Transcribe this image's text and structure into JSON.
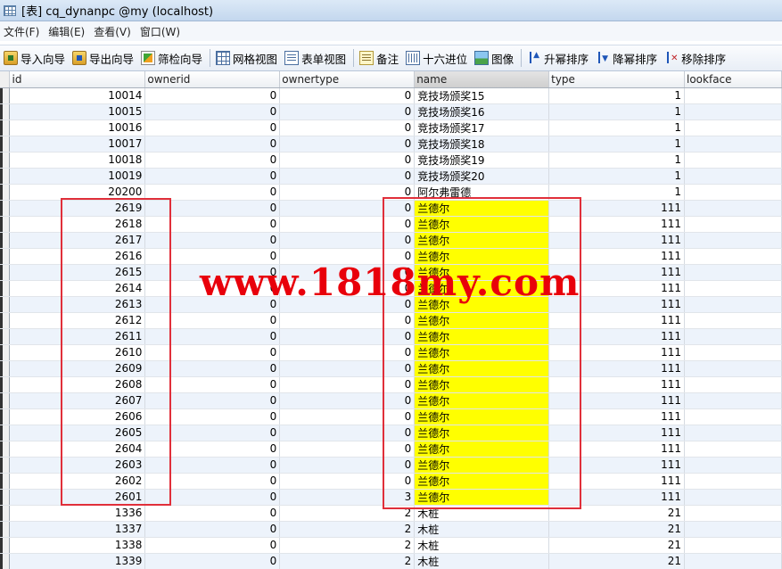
{
  "window": {
    "title": "[表] cq_dynanpc @my (localhost)"
  },
  "menu": [
    "文件(F)",
    "编辑(E)",
    "查看(V)",
    "窗口(W)"
  ],
  "toolbar": {
    "import": "导入向导",
    "export": "导出向导",
    "filter": "筛检向导",
    "grid_view": "网格视图",
    "form_view": "表单视图",
    "memo": "备注",
    "hex": "十六进位",
    "image": "图像",
    "sort_asc": "升幂排序",
    "sort_desc": "降幂排序",
    "remove_sort": "移除排序"
  },
  "columns": [
    "id",
    "ownerid",
    "ownertype",
    "name",
    "type",
    "lookface"
  ],
  "rows": [
    [
      "10014",
      "0",
      "0",
      "竞技场颁奖15",
      "1",
      ""
    ],
    [
      "10015",
      "0",
      "0",
      "竞技场颁奖16",
      "1",
      ""
    ],
    [
      "10016",
      "0",
      "0",
      "竞技场颁奖17",
      "1",
      ""
    ],
    [
      "10017",
      "0",
      "0",
      "竞技场颁奖18",
      "1",
      ""
    ],
    [
      "10018",
      "0",
      "0",
      "竞技场颁奖19",
      "1",
      ""
    ],
    [
      "10019",
      "0",
      "0",
      "竞技场颁奖20",
      "1",
      ""
    ],
    [
      "20200",
      "0",
      "0",
      "阿尔弗雷德",
      "1",
      ""
    ],
    [
      "2619",
      "0",
      "0",
      "兰德尔",
      "111",
      ""
    ],
    [
      "2618",
      "0",
      "0",
      "兰德尔",
      "111",
      ""
    ],
    [
      "2617",
      "0",
      "0",
      "兰德尔",
      "111",
      ""
    ],
    [
      "2616",
      "0",
      "0",
      "兰德尔",
      "111",
      ""
    ],
    [
      "2615",
      "0",
      "0",
      "兰德尔",
      "111",
      ""
    ],
    [
      "2614",
      "0",
      "0",
      "兰德尔",
      "111",
      ""
    ],
    [
      "2613",
      "0",
      "0",
      "兰德尔",
      "111",
      ""
    ],
    [
      "2612",
      "0",
      "0",
      "兰德尔",
      "111",
      ""
    ],
    [
      "2611",
      "0",
      "0",
      "兰德尔",
      "111",
      ""
    ],
    [
      "2610",
      "0",
      "0",
      "兰德尔",
      "111",
      ""
    ],
    [
      "2609",
      "0",
      "0",
      "兰德尔",
      "111",
      ""
    ],
    [
      "2608",
      "0",
      "0",
      "兰德尔",
      "111",
      ""
    ],
    [
      "2607",
      "0",
      "0",
      "兰德尔",
      "111",
      ""
    ],
    [
      "2606",
      "0",
      "0",
      "兰德尔",
      "111",
      ""
    ],
    [
      "2605",
      "0",
      "0",
      "兰德尔",
      "111",
      ""
    ],
    [
      "2604",
      "0",
      "0",
      "兰德尔",
      "111",
      ""
    ],
    [
      "2603",
      "0",
      "0",
      "兰德尔",
      "111",
      ""
    ],
    [
      "2602",
      "0",
      "0",
      "兰德尔",
      "111",
      ""
    ],
    [
      "2601",
      "0",
      "3",
      "兰德尔",
      "111",
      ""
    ],
    [
      "1336",
      "0",
      "2",
      "木桩",
      "21",
      ""
    ],
    [
      "1337",
      "0",
      "2",
      "木桩",
      "21",
      ""
    ],
    [
      "1338",
      "0",
      "2",
      "木桩",
      "21",
      ""
    ],
    [
      "1339",
      "0",
      "2",
      "木桩",
      "21",
      ""
    ]
  ],
  "highlight": {
    "name_color": "#ffff00",
    "box_color": "#e02f3a",
    "first_row": 7,
    "last_row": 25
  },
  "watermark": "www.1818my.com"
}
